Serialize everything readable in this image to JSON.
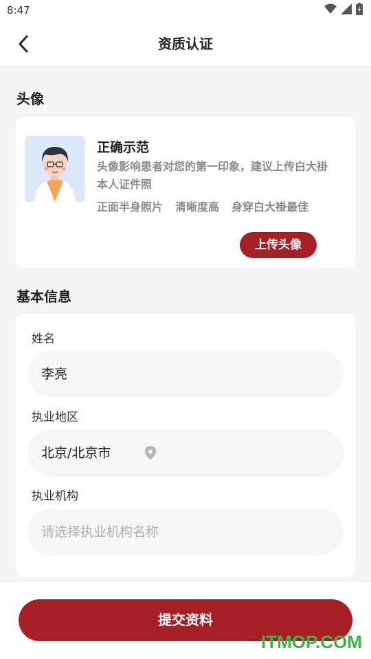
{
  "status_bar": {
    "time": "8:47"
  },
  "nav": {
    "title": "资质认证",
    "back_icon": "chevron-left-icon"
  },
  "avatar_section": {
    "title": "头像",
    "example_title": "正确示范",
    "example_desc": "头像影响患者对您的第一印象，建议上传白大褂本人证件照",
    "tips": [
      "正面半身照片",
      "清晰度高",
      "身穿白大褂最佳"
    ],
    "upload_label": "上传头像"
  },
  "basic_info": {
    "title": "基本信息",
    "name": {
      "label": "姓名",
      "value": "李亮"
    },
    "region": {
      "label": "执业地区",
      "value": "北京/北京市",
      "icon": "location-pin-icon"
    },
    "institution": {
      "label": "执业机构",
      "placeholder": "请选择执业机构名称"
    }
  },
  "submit_label": "提交资料",
  "watermark": "ITMOP.COM",
  "colors": {
    "accent": "#a51f24",
    "background": "#f5f5f5",
    "watermark": "#3fb24a"
  }
}
